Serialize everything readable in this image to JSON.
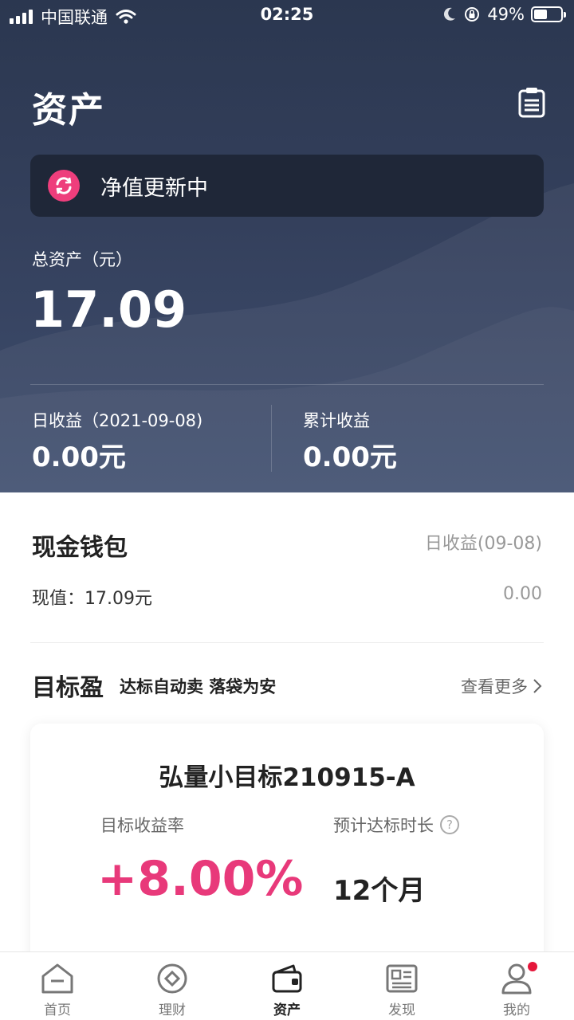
{
  "status_bar": {
    "carrier": "中国联通",
    "time": "02:25",
    "battery_percent": "49%",
    "battery_level": 0.49
  },
  "header": {
    "title": "资产",
    "document_icon": "clipboard-icon"
  },
  "banner": {
    "icon": "refresh-icon",
    "text": "净值更新中",
    "icon_color": "#ee3e7c"
  },
  "summary": {
    "total_label": "总资产（元）",
    "total_value": "17.09",
    "daily_label": "日收益（2021-09-08)",
    "daily_value": "0.00元",
    "cumulative_label": "累计收益",
    "cumulative_value": "0.00元"
  },
  "wallet": {
    "title": "现金钱包",
    "income_label": "日收益(09-08)",
    "value_text": "现值：17.09元",
    "income_value": "0.00"
  },
  "goal": {
    "title": "目标盈",
    "tagline": "达标自动卖 落袋为安",
    "more_label": "查看更多",
    "card": {
      "name": "弘量小目标210915-A",
      "rate_label": "目标收益率",
      "rate_value": "+8.00%",
      "duration_label": "预计达标时长",
      "duration_value": "12个月"
    }
  },
  "tabs": [
    {
      "label": "首页",
      "icon": "home-icon",
      "active": false
    },
    {
      "label": "理财",
      "icon": "finance-icon",
      "active": false
    },
    {
      "label": "资产",
      "icon": "wallet-icon",
      "active": true
    },
    {
      "label": "发现",
      "icon": "news-icon",
      "active": false
    },
    {
      "label": "我的",
      "icon": "profile-icon",
      "active": false
    }
  ],
  "colors": {
    "hero_bg": "#2b3750",
    "accent": "#e8397a",
    "notification_dot": "#e5163a"
  }
}
